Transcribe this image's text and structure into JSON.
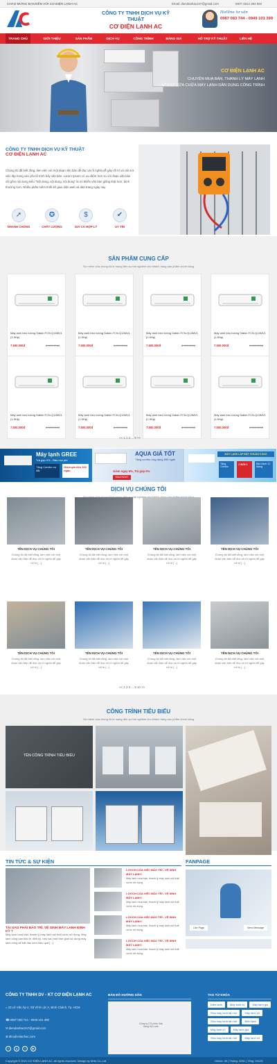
{
  "topbar": {
    "welcome": "CHÀO MỪNG BẠN ĐẾN VỚI CƠ ĐIỆN LẠNH AC",
    "email": "Email: diendanhac247@gmail.com",
    "vat": "MST: 0314 264 584"
  },
  "header": {
    "company_line1": "CÔNG TY TNHH DỊCH VỤ KỸ THUẬT",
    "company_line2": "CƠ ĐIỆN LẠNH AC",
    "cursive": "Hotline tư vấn",
    "hotline": "0987 083 744 - 0949 101 399"
  },
  "nav": [
    "TRANG CHỦ",
    "GIỚI THIỆU",
    "SẢN PHẨM",
    "DỊCH VỤ",
    "CÔNG TRÌNH",
    "BẢNG GIÁ",
    "HỖ TRỢ KỸ THUẬT",
    "LIÊN HỆ"
  ],
  "hero": {
    "title": "CƠ ĐIỆN LẠNH AC",
    "line1": "CHUYÊN MUA BÁN, THANH LÝ MÁY LẠNH",
    "line2": "LẮP ĐẶT SỬA CHỮA MÁY LẠNH DÂN DỤNG CÔNG TRÌNH"
  },
  "about": {
    "title1": "CÔNG TY TNHH DỊCH VỤ KỸ THUẬT",
    "title2": "CƠ ĐIỆN LẠNH AC",
    "desc": "Chúng tôi đã biết rằng, làm việc với một đoạn văn bản dễ đọc và rõ nghĩa dễ gây rối trí và cản trở việc tập trung vào yếu tố trình bày văn bản. Lorem Ipsum có ưu điểm hơn so với đoạn văn bản chỉ gồm nội dung kiểu \"Nội dung, nội dung, nội dung\" là nó khiến văn bản giống thật hơn, bình thường hơn. Nhiều phần mềm thiết kế giao diện web và dàn trang ngày nay",
    "features": [
      "NHANH CHÓNG",
      "CHẤT LƯỢNG",
      "GIÁ CẢ HỢP LÝ",
      "UY TÍN"
    ]
  },
  "products": {
    "heading": "SẢN PHẨM CUNG CẤP",
    "sub": "Sứ mệnh của chúng tôi là mang đến sự trải nghiệm cho khách hàng sản phẩm chính hãng",
    "items": [
      {
        "name": "Máy lạnh treo tường Daikin FCN-Q13MV1 (1.5Hp)",
        "price": "7.500.000đ",
        "old": "8.000.000đ"
      },
      {
        "name": "Máy lạnh treo tường Daikin FCN-Q13MV1 (1.5Hp)",
        "price": "7.500.000đ",
        "old": "8.000.000đ"
      },
      {
        "name": "Máy lạnh treo tường Daikin FCN-Q13MV1 (1.5Hp)",
        "price": "7.500.000đ",
        "old": "8.000.000đ"
      },
      {
        "name": "Máy lạnh treo tường Daikin FCN-Q13MV1 (1.5Hp)",
        "price": "7.500.000đ",
        "old": "8.000.000đ"
      },
      {
        "name": "Máy lạnh treo tường Daikin FCN-Q13MV1 (1.5Hp)",
        "price": "7.500.000đ",
        "old": "8.000.000đ"
      },
      {
        "name": "Máy lạnh treo tường Daikin FCN-Q13MV1 (1.5Hp)",
        "price": "7.500.000đ",
        "old": "8.000.000đ"
      },
      {
        "name": "Máy lạnh treo tường Daikin FCN-Q13MV1 (1.5Hp)",
        "price": "7.500.000đ",
        "old": "8.000.000đ"
      },
      {
        "name": "Máy lạnh treo tường Daikin FCN-Q13MV1 (1.5Hp)",
        "price": "7.500.000đ",
        "old": "8.000.000đ"
      }
    ],
    "pager": "<< 1 2 3 ... 9 >>"
  },
  "banners": [
    {
      "t1": "Máy lạnh GREE",
      "t2": "Trả góp 0% - Bảo mọi phí",
      "t3": "Tặng Combo ưu đãi",
      "t4": "Giảm giá đến 300 ngàn"
    },
    {
      "t1": "AQUA GIÁ TỐT",
      "t2": "Tặng combo ứng dụng 650 ngàn",
      "t3": "Giảm ngay 5%, Trả góp 0%",
      "t4": "MUA NGAY"
    },
    {
      "t1": "MÁY LẠNH LẮP ĐẶT CHUẨN 5 SAO",
      "t2": "Tặng Combo",
      "t3": "1 ĐỔI 1",
      "t4": "Bảo hành 12 tháng"
    }
  ],
  "services": {
    "heading": "DỊCH VỤ CHÚNG TÔI",
    "sub": "Sứ mệnh của chúng tôi là mang đến sự trải nghiệm cho khách hàng sản phẩm chính hãng",
    "item_title": "TÊN DỊCH VỤ CHÚNG TÔI",
    "item_desc": "Chúng tôi đã biết rằng, làm việc với một đoạn văn bản dễ đọc và rõ nghĩa dễ gây rối trí [...]",
    "pager": "<< 1 2 3 ... 9 10 >>"
  },
  "projects": {
    "heading": "CÔNG TRÌNH TIÊU BIỂU",
    "sub": "Sứ mệnh của chúng tôi là mang đến sự trải nghiệm cho khách hàng sản phẩm chính hãng",
    "overlay": "TÊN CÔNG TRÌNH TIÊU BIỂU"
  },
  "news": {
    "heading": "TIN TỨC & SỰ KIỆN",
    "main_title": "TẠI SAO PHẢI BẢO TRÌ, VỆ SINH MÁY LẠNH ĐỊNH KỲ ?",
    "main_desc": "Máy lạnh mua bán, thanh lý máy lạnh nội thất cước sử dụng. Máy lạnh cũng cần bảo trì định kỳ, nếu sau một thời gian sử dụng máy lạnh cũng sẽ bắt đầu kém hiệu quả [...]",
    "side": [
      {
        "t": "LỢI ÍCH CỦA VIỆC BẢO TRÌ - VỆ SINH MÁY LẠNH !",
        "d": "Máy lạnh mua bán, thanh lý máy lạnh nội thất cước sử dụng."
      },
      {
        "t": "LỢI ÍCH CỦA VIỆC BẢO TRÌ - VỆ SINH MÁY LẠNH !",
        "d": "Máy lạnh mua bán, thanh lý máy lạnh nội thất cước sử dụng."
      },
      {
        "t": "LỢI ÍCH CỦA VIỆC BẢO TRÌ - VỆ SINH MÁY LẠNH !",
        "d": "Máy lạnh mua bán, thanh lý máy lạnh nội thất cước sử dụng."
      },
      {
        "t": "LỢI ÍCH CỦA VIỆC BẢO TRÌ - VỆ SINH MÁY LẠNH !",
        "d": "Máy lạnh mua bán, thanh lý máy lạnh nội thất cước sử dụng."
      }
    ],
    "fanpage": "FANPAGE",
    "fb_like": "Like Page",
    "fb_send": "Send Message"
  },
  "footer": {
    "company": "CÔNG TY TNHH DV - KT CƠ ĐIỆN LẠNH AC",
    "address": "23 Lê Văn Âp 4, Xã Vĩnh Lộc A, Bình Chánh, Tp. HCM",
    "phone": "0987 083 744 - 0949 101 399",
    "email": "diendanhac247@gmail.com",
    "website": "dtcodienlanhac.com",
    "map_title": "BẢN ĐỒ HƯỚNG DẪN",
    "map_label": "Công ty Cổ phần Xây dựng Kỹ Luận",
    "tags_title": "TAG TỪ KHÓA",
    "tags": [
      "Điện lạnh",
      "Máy lạnh cũ",
      "Máy lạnh gia",
      "Sửa máy lạnh tận nơi",
      "Máy lạnh cũ",
      "Sửa máy lạnh tận nơi",
      "Điện lạnh",
      "Máy lạnh cũ",
      "Máy lạnh gia",
      "Sửa máy lạnh tận nơi",
      "Máy lạnh cũ"
    ],
    "copyright": "Copyright © 2021 CƠ ĐIỆN LẠNH AC. All rights reserved. Design by Nhtu Co.,Ltd",
    "stats": "Online: 32  |  Tháng: 3251  |  Tổng: 94125"
  },
  "colors": {
    "blue": "#1d6fb8",
    "red": "#e12a30",
    "footer": "#1f6fb4"
  }
}
